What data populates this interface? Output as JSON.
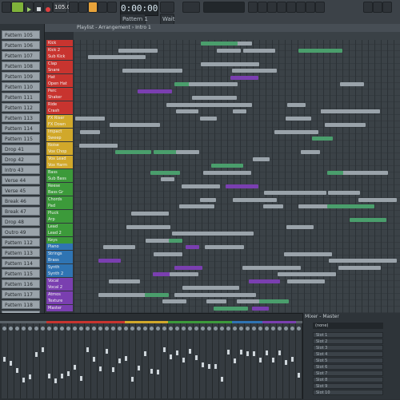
{
  "toolbar": {
    "pattern_label": "Pattern 1",
    "time": "0:00:00",
    "tempo": "105.000",
    "menu_items": [
      "FILE",
      "EDIT",
      "ADD",
      "PATTERNS",
      "VIEW",
      "OPTIONS",
      "TOOLS",
      "HELP"
    ],
    "hint": "Wait"
  },
  "playlist": {
    "title": "Playlist - Arrangement › Intro 1"
  },
  "browser": {
    "items": [
      "Pattern 105",
      "Pattern 106",
      "Pattern 107",
      "Pattern 108",
      "Pattern 109",
      "Pattern 110",
      "Pattern 111",
      "Pattern 112",
      "Pattern 113",
      "Pattern 114",
      "Pattern 115",
      "Drop 41",
      "Drop 42",
      "Intro 43",
      "Verse 44",
      "Verse 45",
      "Break 46",
      "Break 47",
      "Drop 48",
      "Outro 49",
      "Pattern 112",
      "Pattern 113",
      "Pattern 114",
      "Pattern 115",
      "Pattern 116",
      "Pattern 117",
      "Pattern 118",
      "Pattern 119"
    ]
  },
  "tracks": [
    {
      "name": "Kick",
      "color": "#c8342f"
    },
    {
      "name": "Kick 2",
      "color": "#c8342f"
    },
    {
      "name": "Sub Kick",
      "color": "#c8342f"
    },
    {
      "name": "Clap",
      "color": "#c8342f"
    },
    {
      "name": "Snare",
      "color": "#c8342f"
    },
    {
      "name": "Hat",
      "color": "#c8342f"
    },
    {
      "name": "Open Hat",
      "color": "#c8342f"
    },
    {
      "name": "Perc",
      "color": "#c8342f"
    },
    {
      "name": "Shaker",
      "color": "#c8342f"
    },
    {
      "name": "Ride",
      "color": "#c8342f"
    },
    {
      "name": "Crash",
      "color": "#c8342f"
    },
    {
      "name": "FX Riser",
      "color": "#d1a82a"
    },
    {
      "name": "FX Down",
      "color": "#d1a82a"
    },
    {
      "name": "Impact",
      "color": "#d1a82a"
    },
    {
      "name": "Sweep",
      "color": "#d1a82a"
    },
    {
      "name": "Noise",
      "color": "#d1a82a"
    },
    {
      "name": "Vox Chop",
      "color": "#d1a82a"
    },
    {
      "name": "Vox Lead",
      "color": "#d1a82a"
    },
    {
      "name": "Vox Harm",
      "color": "#d1a82a"
    },
    {
      "name": "Bass",
      "color": "#3c9a3a"
    },
    {
      "name": "Sub Bass",
      "color": "#3c9a3a"
    },
    {
      "name": "Reese",
      "color": "#3c9a3a"
    },
    {
      "name": "Bass Gr",
      "color": "#3c9a3a"
    },
    {
      "name": "Chords",
      "color": "#3c9a3a"
    },
    {
      "name": "Pad",
      "color": "#3c9a3a"
    },
    {
      "name": "Pluck",
      "color": "#3c9a3a"
    },
    {
      "name": "Arp",
      "color": "#3c9a3a"
    },
    {
      "name": "Lead",
      "color": "#3c9a3a"
    },
    {
      "name": "Lead 2",
      "color": "#3c9a3a"
    },
    {
      "name": "Keys",
      "color": "#3c9a3a"
    },
    {
      "name": "Piano",
      "color": "#2f74b3"
    },
    {
      "name": "Strings",
      "color": "#2f74b3"
    },
    {
      "name": "Brass",
      "color": "#2f74b3"
    },
    {
      "name": "Synth",
      "color": "#2f74b3"
    },
    {
      "name": "Synth 2",
      "color": "#2f74b3"
    },
    {
      "name": "Vocal",
      "color": "#7a3fb0"
    },
    {
      "name": "Vocal 2",
      "color": "#7a3fb0"
    },
    {
      "name": "Atmos",
      "color": "#7a3fb0"
    },
    {
      "name": "Texture",
      "color": "#7a3fb0"
    },
    {
      "name": "Master",
      "color": "#7a3fb0"
    }
  ],
  "mixer": {
    "title": "Mixer - Master",
    "section_colors": [
      "#5a6268",
      "#c8342f",
      "#d1a82a",
      "#3c9a3a",
      "#2f74b3",
      "#7a3fb0",
      "#5a6268"
    ],
    "slots": [
      "Slot 1",
      "Slot 2",
      "Slot 3",
      "Slot 4",
      "Slot 5",
      "Slot 6",
      "Slot 7",
      "Slot 8",
      "Slot 9",
      "Slot 10"
    ],
    "preset": "(none)"
  },
  "colors": {
    "accent": "#e8a33a",
    "clip_default": "#9aa3aa",
    "clip_active": "#4a9e6c",
    "clip_purple": "#7a3fb0"
  }
}
